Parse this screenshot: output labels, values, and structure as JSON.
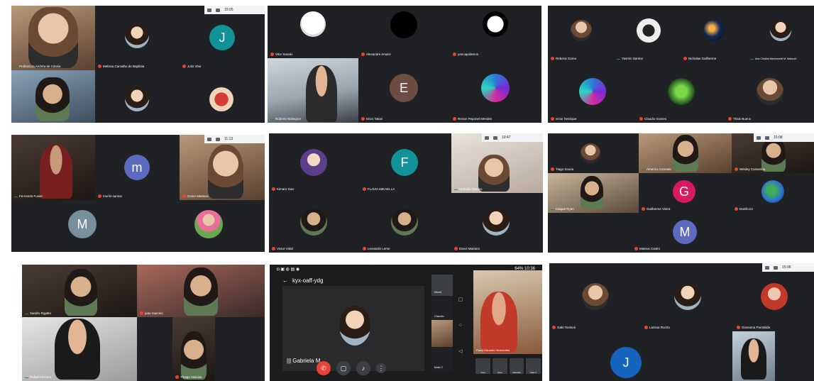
{
  "panels": [
    {
      "time": "15:05",
      "tiles": [
        {
          "name": "Professora Andréa de Cássia"
        },
        {
          "name": "Melissa Carvalho de Baptista"
        },
        {
          "name": "Julio Vitor",
          "initial": "J"
        },
        {
          "name": ""
        },
        {
          "name": ""
        },
        {
          "name": ""
        }
      ]
    },
    {
      "tiles": [
        {
          "name": "Vitor Sasaki"
        },
        {
          "name": "Alexandre Amaro"
        },
        {
          "name": "yancapolamos"
        },
        {
          "name": "Roberto Balieguer"
        },
        {
          "name": "Enzo Tatian",
          "initial": "E"
        },
        {
          "name": "Renan Peponel Mendes"
        }
      ]
    },
    {
      "tiles": [
        {
          "name": "Rebeca Gama"
        },
        {
          "name": "Yasmin Santos"
        },
        {
          "name": "Nicholas Guilherme"
        },
        {
          "name": "Ana Cristina Marchezetti M. Malucch"
        },
        {
          "name": "victor henrique"
        },
        {
          "name": "Claudio Gomes"
        },
        {
          "name": "Thais Bueno"
        }
      ]
    },
    {
      "time": "11:13",
      "tiles": [
        {
          "name": "Fernando Fusier"
        },
        {
          "name": "murilo santos",
          "initial": "m"
        },
        {
          "name": "Cesre Mariano"
        },
        {
          "name": "",
          "initial": "M"
        },
        {
          "name": ""
        }
      ]
    },
    {
      "time": "10:47",
      "tiles": [
        {
          "name": "Kimaro Gan"
        },
        {
          "name": "FLAVIA MIKAELLA",
          "initial": "F"
        },
        {
          "name": "Nathalia Martins"
        },
        {
          "name": "Victor Vidal"
        },
        {
          "name": "Leonardo Leme"
        },
        {
          "name": "Davoi Mariano"
        }
      ]
    },
    {
      "time": "15:08",
      "tiles": [
        {
          "name": "Tiago Souza"
        },
        {
          "name": "Americo Conrado"
        },
        {
          "name": "Wesley Cassarina"
        },
        {
          "name": "Kaique Ryan"
        },
        {
          "name": "Guilherme Vieira",
          "initial": "G"
        },
        {
          "name": "Danillo13"
        },
        {
          "name": "Mateus Castro",
          "initial": "M"
        }
      ]
    },
    {
      "tiles": [
        {
          "name": "Sandro Rigatto"
        },
        {
          "name": "joao marcelo"
        },
        {
          "name": "Rafael Ferreira"
        },
        {
          "name": "Thiago Vinicius"
        }
      ]
    },
    {
      "status_time": "10:36",
      "battery": "64%",
      "meeting_code": "kyx-oaff-ydg",
      "presenter_name": "Gabriela M",
      "side_tiles": [
        "Nicoli",
        "Claudio",
        "",
        "Mais 3"
      ],
      "big_name": "Paulo Eduardo Hernandes",
      "thumbs": [
        "Voce",
        "Voce",
        "Gabriela",
        "Mais 3"
      ]
    },
    {
      "time": "15:06",
      "tiles": [
        {
          "name": "Gabi Tonisuti"
        },
        {
          "name": "Larissa Rocha"
        },
        {
          "name": "Giovanna Parrabida"
        },
        {
          "name": "",
          "initial": "J"
        },
        {
          "name": ""
        }
      ]
    }
  ]
}
